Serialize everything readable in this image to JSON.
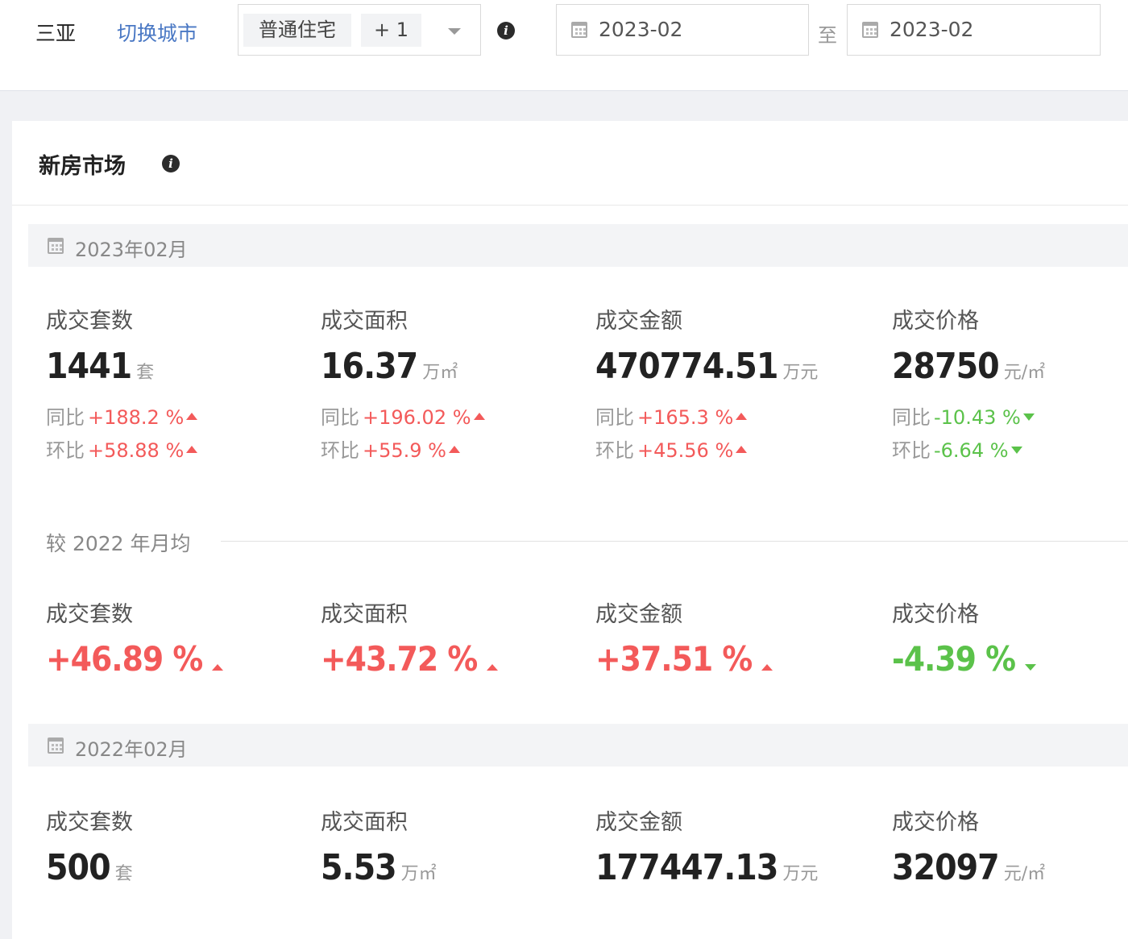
{
  "toolbar": {
    "city": "三亚",
    "switch_city": "切换城市",
    "type_tag": "普通住宅",
    "type_more": "+ 1",
    "date_start": "2023-02",
    "to": "至",
    "date_end": "2023-02"
  },
  "card": {
    "title": "新房市场",
    "current_period": "2023年02月",
    "compare_title": "较 2022 年月均",
    "previous_period": "2022年02月"
  },
  "labels": {
    "yoy": "同比",
    "mom": "环比"
  },
  "current": [
    {
      "label": "成交套数",
      "value": "1441",
      "unit": "套",
      "yoy": "+188.2 %",
      "yoy_dir": "up",
      "mom": "+58.88 %",
      "mom_dir": "up"
    },
    {
      "label": "成交面积",
      "value": "16.37",
      "unit": "万㎡",
      "yoy": "+196.02 %",
      "yoy_dir": "up",
      "mom": "+55.9 %",
      "mom_dir": "up"
    },
    {
      "label": "成交金额",
      "value": "470774.51",
      "unit": "万元",
      "yoy": "+165.3 %",
      "yoy_dir": "up",
      "mom": "+45.56 %",
      "mom_dir": "up"
    },
    {
      "label": "成交价格",
      "value": "28750",
      "unit": "元/㎡",
      "yoy": "-10.43 %",
      "yoy_dir": "down",
      "mom": "-6.64 %",
      "mom_dir": "down"
    }
  ],
  "vs_avg": [
    {
      "label": "成交套数",
      "value": "+46.89 %",
      "dir": "up"
    },
    {
      "label": "成交面积",
      "value": "+43.72 %",
      "dir": "up"
    },
    {
      "label": "成交金额",
      "value": "+37.51 %",
      "dir": "up"
    },
    {
      "label": "成交价格",
      "value": "-4.39 %",
      "dir": "down"
    }
  ],
  "previous": [
    {
      "label": "成交套数",
      "value": "500",
      "unit": "套"
    },
    {
      "label": "成交面积",
      "value": "5.53",
      "unit": "万㎡"
    },
    {
      "label": "成交金额",
      "value": "177447.13",
      "unit": "万元"
    },
    {
      "label": "成交价格",
      "value": "32097",
      "unit": "元/㎡"
    }
  ]
}
